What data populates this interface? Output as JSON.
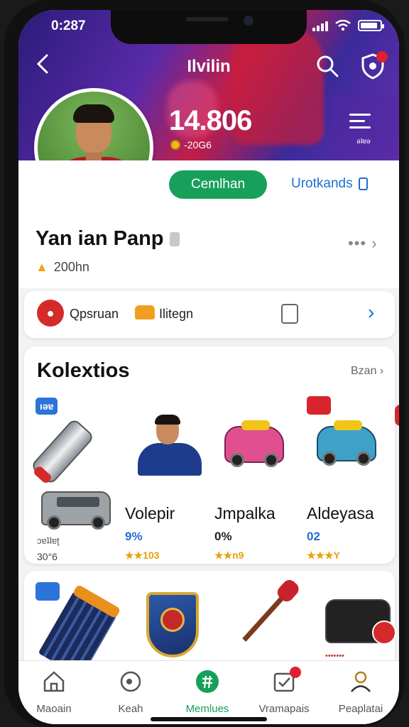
{
  "status": {
    "time": "0:287"
  },
  "nav": {
    "title": "Ilvilin"
  },
  "profile": {
    "score": "14.806",
    "coins": "-20G6",
    "list_label": "ǝʇɐǝ",
    "follow_label": "Cemlhan",
    "link_label": "Urotkands",
    "name": "Yan ian Panp",
    "sub_value": "200hn",
    "more_label": "••• ›"
  },
  "info_row": {
    "item1": "Qpsruan",
    "item2": "Ilitegn",
    "chevron": "›"
  },
  "collection": {
    "title": "Kolextios",
    "more_label": "Bzan ›",
    "tag_label": "ıǝɐ",
    "van_line1": "ɔɐʇʇɐʈ",
    "van_line2": "30°6",
    "items": [
      {
        "name": "Volepir",
        "pct": "9%",
        "stars": "★★103",
        "pct_color": "#1f6fd1"
      },
      {
        "name": "Jmpalka",
        "pct": "0%",
        "stars": "★★n9",
        "pct_color": "#222222"
      },
      {
        "name": "Aldeyasa",
        "pct": "02",
        "stars": "★★★Y",
        "pct_color": "#1f6fd1"
      }
    ],
    "bag_label": "•••••••"
  },
  "tabs": [
    {
      "label": "Maoain",
      "icon": "home-icon"
    },
    {
      "label": "Keah",
      "icon": "search-icon"
    },
    {
      "label": "Memlues",
      "icon": "menu-icon"
    },
    {
      "label": "Vramapais",
      "icon": "checkbox-icon"
    },
    {
      "label": "Peaplatai",
      "icon": "person-icon"
    }
  ],
  "colors": {
    "accent_green": "#16a05a",
    "link_blue": "#1f6fd1",
    "badge_red": "#e02030"
  }
}
